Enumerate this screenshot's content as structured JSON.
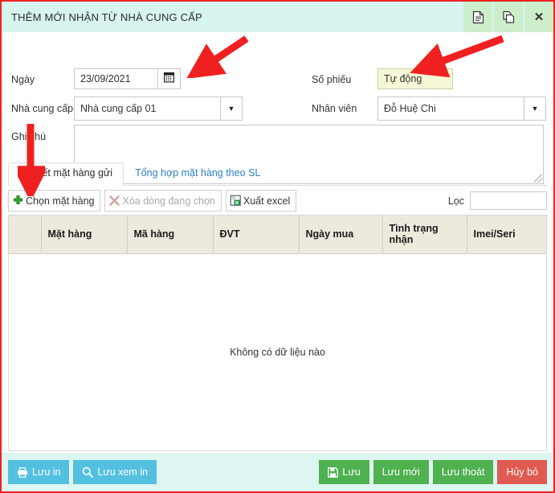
{
  "window": {
    "title": "THÊM MỚI NHẬN TỪ NHÀ CUNG CẤP",
    "buttons": [
      {
        "name": "document-icon",
        "label": ""
      },
      {
        "name": "copy-icon",
        "label": ""
      },
      {
        "name": "close-icon",
        "label": "✕"
      }
    ]
  },
  "form": {
    "date": {
      "label": "Ngày",
      "value": "23/09/2021",
      "icon": "calendar-icon"
    },
    "supplier": {
      "label": "Nhà cung cấp",
      "value": "Nhà cung cấp 01",
      "icon": "chevron-down-icon"
    },
    "note": {
      "label": "Ghi chú",
      "value": "",
      "placeholder": ""
    },
    "voucher_no": {
      "label": "Số phiếu",
      "value": "Tự động",
      "background": "#f5f7d6"
    },
    "employee": {
      "label": "Nhân viên",
      "value": "Đỗ Huệ Chi",
      "icon": "chevron-down-icon"
    }
  },
  "tabs": [
    {
      "label": "Chi tiết mặt hàng gửi",
      "active": true
    },
    {
      "label": "Tổng hợp mặt hàng theo SL",
      "active": false
    }
  ],
  "grid_toolbar": {
    "buttons": [
      {
        "label": "Chọn mặt hàng",
        "icon": "plus-icon",
        "disabled": false
      },
      {
        "label": "Xóa dòng đang chọn",
        "icon": "x-red-icon",
        "disabled": true
      },
      {
        "label": "Xuất excel",
        "icon": "excel-icon",
        "disabled": false
      }
    ],
    "filter": {
      "label": "Lọc",
      "value": "",
      "placeholder": ""
    }
  },
  "grid": {
    "columns": [
      "",
      "Mặt hàng",
      "Mã hàng",
      "ĐVT",
      "Ngày mua",
      "Tình trạng nhận",
      "Imei/Seri"
    ],
    "rows": [],
    "empty_message": "Không có dữ liệu nào"
  },
  "footer": {
    "left_buttons": [
      {
        "label": "Lưu in",
        "icon": "printer-icon",
        "style": "info"
      },
      {
        "label": "Lưu xem in",
        "icon": "search-icon",
        "style": "info"
      }
    ],
    "right_buttons": [
      {
        "label": "Lưu",
        "icon": "save-icon",
        "style": "ok"
      },
      {
        "label": "Lưu mới",
        "icon": "",
        "style": "ok"
      },
      {
        "label": "Lưu thoát",
        "icon": "",
        "style": "ok"
      },
      {
        "label": "Hủy bỏ",
        "icon": "",
        "style": "danger"
      }
    ]
  },
  "colors": {
    "header_bg": "#d7f4ef",
    "footer_bg": "#ddf6f1",
    "accent_green": "#4fb14f",
    "accent_blue": "#54c0e0",
    "accent_red": "#e05a52",
    "annotation_red": "#ee2222",
    "grid_header_bg": "#ede9dd"
  }
}
